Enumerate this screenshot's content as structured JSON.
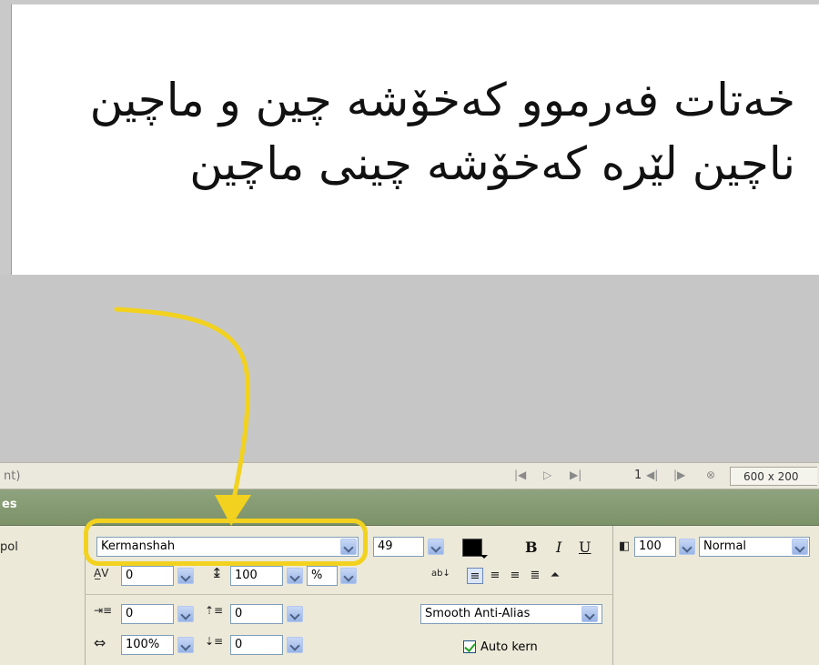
{
  "canvas": {
    "line1": "خەتات فەرموو کەخۆشە چین و ماچین",
    "line2": "ناچین لێرە کەخۆشە چینی ماچین"
  },
  "status_bar": {
    "left_text": "nt)",
    "frame_number": "1",
    "canvas_size": "600 x 200"
  },
  "properties": {
    "header_text": "es",
    "tool_label": "pol",
    "font_name": "Kermanshah",
    "font_size": "49",
    "bold_label": "B",
    "italic_label": "I",
    "underline_label": "U",
    "kerning_value": "0",
    "leading_value": "100",
    "leading_unit": "%",
    "opacity_value": "100",
    "blend_mode": "Normal",
    "indent_value": "0",
    "space_before_value": "0",
    "horizontal_scale": "100%",
    "space_after_value": "0",
    "anti_alias": "Smooth Anti-Alias",
    "auto_kern_label": "Auto kern",
    "auto_kern_checked": true
  },
  "colors": {
    "highlight": "#f2d21e",
    "text_color": "#000000",
    "header_green": "#7c9268"
  }
}
